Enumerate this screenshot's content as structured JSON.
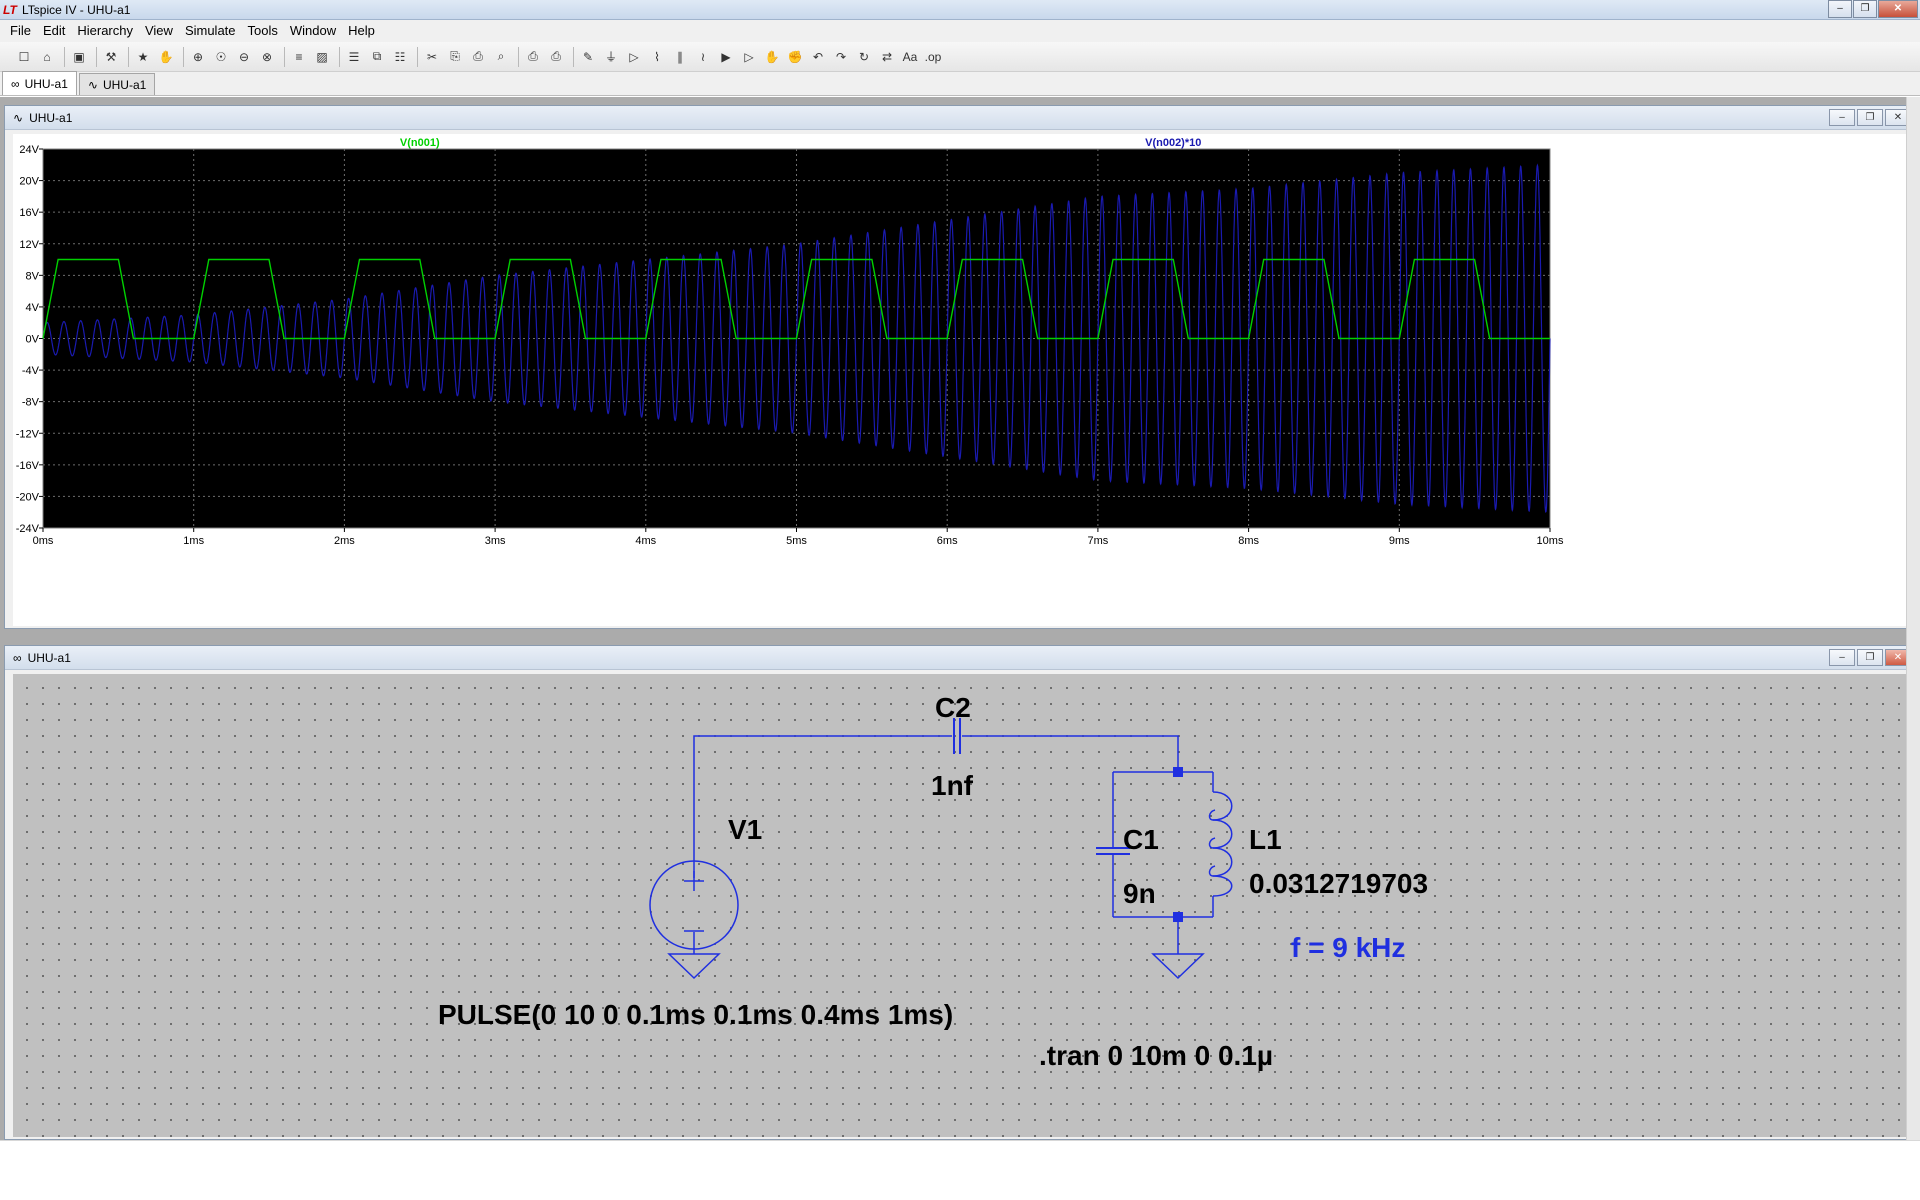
{
  "window": {
    "title": "LTspice IV - UHU-a1"
  },
  "menubar": {
    "items": [
      "File",
      "Edit",
      "Hierarchy",
      "View",
      "Simulate",
      "Tools",
      "Window",
      "Help"
    ]
  },
  "toolbar": {
    "buttons": [
      "new-schematic-icon",
      "open-icon",
      "|",
      "save-icon",
      "|",
      "control-panel-icon",
      "|",
      "run-icon",
      "halt-icon",
      "|",
      "zoom-in-icon",
      "zoom-fit-icon",
      "zoom-out-icon",
      "cancel-zoom-icon",
      "|",
      "autorange-icon",
      "mark-unref-icon",
      "|",
      "tile-horizontal-icon",
      "cascade-icon",
      "tile-vertical-icon",
      "|",
      "cut-icon",
      "copy-icon",
      "paste-icon",
      "find-icon",
      "|",
      "print-preview-icon",
      "print-icon",
      "|",
      "draw-wire-icon",
      "ground-icon",
      "label-net-icon",
      "resistor-icon",
      "capacitor-icon",
      "inductor-icon",
      "diode-icon",
      "component-icon",
      "move-icon",
      "drag-icon",
      "undo-icon",
      "redo-icon",
      "rotate-icon",
      "mirror-icon",
      "text-icon",
      "spice-directive-icon"
    ]
  },
  "tabs": [
    {
      "label": "UHU-a1",
      "kind": "schematic",
      "active": true
    },
    {
      "label": "UHU-a1",
      "kind": "waveform",
      "active": false
    }
  ],
  "waveform_window": {
    "title": "UHU-a1"
  },
  "schematic_window": {
    "title": "UHU-a1"
  },
  "chart_data": {
    "type": "line",
    "xlabel": "",
    "ylabel": "",
    "xlim": [
      0,
      10
    ],
    "ylim": [
      -24,
      24
    ],
    "x_ticks": [
      "0ms",
      "1ms",
      "2ms",
      "3ms",
      "4ms",
      "5ms",
      "6ms",
      "7ms",
      "8ms",
      "9ms",
      "10ms"
    ],
    "y_ticks": [
      "24V",
      "20V",
      "16V",
      "12V",
      "8V",
      "4V",
      "0V",
      "-4V",
      "-8V",
      "-12V",
      "-16V",
      "-20V",
      "-24V"
    ],
    "grid": true,
    "background": "#000000",
    "series": [
      {
        "name": "V(n001)",
        "color": "#00d000",
        "kind": "pulse",
        "v1": 0,
        "v2": 10,
        "delay_ms": 0,
        "rise_ms": 0.1,
        "fall_ms": 0.1,
        "on_ms": 0.4,
        "period_ms": 1
      },
      {
        "name": "V(n002)*10",
        "color": "#1a1ab0",
        "kind": "growing_oscillation",
        "frequency_khz": 9,
        "envelope_v": [
          [
            0,
            2
          ],
          [
            1,
            3
          ],
          [
            2,
            5
          ],
          [
            3,
            8
          ],
          [
            4,
            10
          ],
          [
            5,
            12
          ],
          [
            6,
            15
          ],
          [
            7,
            18
          ],
          [
            8,
            19
          ],
          [
            9,
            21
          ],
          [
            10,
            22
          ]
        ]
      }
    ]
  },
  "schematic": {
    "components": {
      "c2": {
        "ref": "C2",
        "value": "1nf"
      },
      "v1": {
        "ref": "V1",
        "value": "PULSE(0 10 0 0.1ms 0.1ms 0.4ms 1ms)"
      },
      "c1": {
        "ref": "C1",
        "value": "9n"
      },
      "l1": {
        "ref": "L1",
        "value": "0.0312719703"
      }
    },
    "comment": "f = 9 kHz",
    "directive": ".tran 0 10m 0 0.1µ",
    "colors": {
      "wire": "#1f2fe0",
      "junction": "#1f2fe0",
      "component": "#1f2fe0",
      "text": "#000000",
      "comment": "#1f2fe0"
    }
  }
}
